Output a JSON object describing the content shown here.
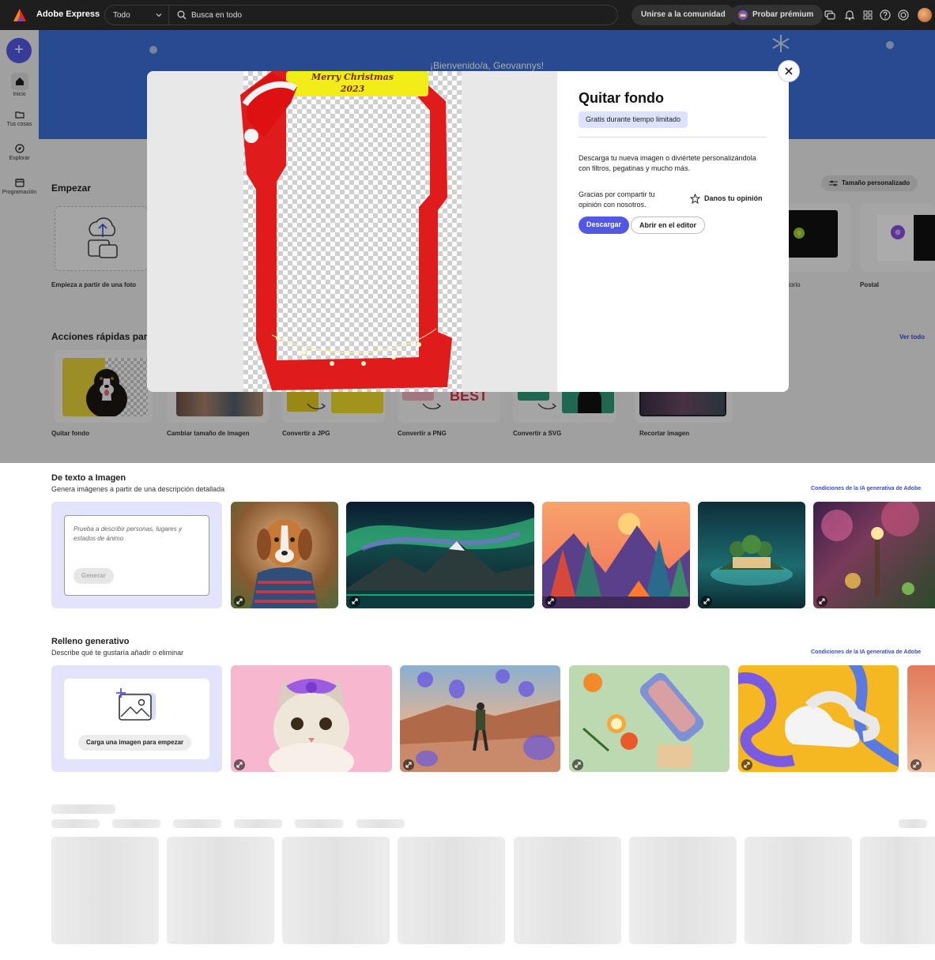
{
  "topbar": {
    "app_title": "Adobe Express",
    "scope_value": "Todo",
    "search_placeholder": "Busca en todo",
    "community_label": "Unirse a la comunidad",
    "premium_label": "Probar prémium"
  },
  "rail": {
    "items": [
      {
        "label": "Inicio"
      },
      {
        "label": "Tus cosas"
      },
      {
        "label": "Explorar"
      },
      {
        "label": "Programación"
      }
    ]
  },
  "hero": {
    "greeting": "¡Bienvenido/a, Geovannys!"
  },
  "start": {
    "title": "Empezar",
    "from_photo": "Empieza a partir de una foto",
    "custom_size": "Tamaño personalizado",
    "partial_label": "torio",
    "postal": "Postal"
  },
  "quick_actions": {
    "title": "Acciones rápidas para f",
    "view_all": "Ver todo",
    "items": [
      {
        "label": "Quitar fondo"
      },
      {
        "label": "Cambiar tamaño de imagen"
      },
      {
        "label": "Convertir a JPG"
      },
      {
        "label": "Convertir a PNG"
      },
      {
        "label": "Convertir a SVG"
      },
      {
        "label": "Recortar imagen"
      }
    ],
    "png_thumb_text": "BEST"
  },
  "modal": {
    "title": "Quitar fondo",
    "badge": "Gratis durante tiempo limitado",
    "description": "Descarga tu nueva imagen o diviértete personalizándola con filtros, pegatinas y mucho más.",
    "thanks": "Gracias por compartir tu opinión con nosotros.",
    "feedback": "Danos tu opinión",
    "download": "Descargar",
    "open_editor": "Abrir en el editor",
    "image_text_line1": "Merry Christmas",
    "image_text_line2": "2023"
  },
  "text_to_image": {
    "title": "De texto a Imagen",
    "subtitle": "Genera imágenes a partir de una descripción detallada",
    "terms": "Condiciones de la IA generativa de Adobe",
    "placeholder": "Prueba a describir personas, lugares y estados de ánimo",
    "generate": "Generar"
  },
  "generative_fill": {
    "title": "Relleno generativo",
    "subtitle": "Describe qué te gustaría añadir o eliminar",
    "terms": "Condiciones de la IA generativa de Adobe",
    "upload": "Carga una imagen para empezar"
  },
  "colors": {
    "accent": "#5258e4",
    "hero_blue": "#3b6fd8",
    "topbar": "#1e1e1e",
    "frame_red": "#e01b1b",
    "frame_yellow": "#f2ec18"
  }
}
